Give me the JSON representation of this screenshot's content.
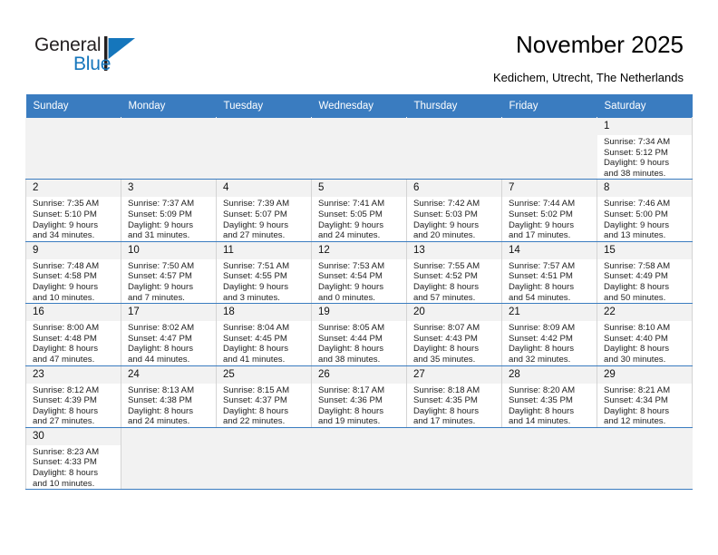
{
  "brand": {
    "name_top": "General",
    "name_bottom": "Blue",
    "flag_icon": "blue-triangle-flag-icon",
    "accent_color": "#1576bc"
  },
  "header": {
    "title": "November 2025",
    "subtitle": "Kedichem, Utrecht, The Netherlands"
  },
  "calendar": {
    "header_bg": "#3a7cc0",
    "daynum_bg": "#f2f2f2",
    "weekdays": [
      "Sunday",
      "Monday",
      "Tuesday",
      "Wednesday",
      "Thursday",
      "Friday",
      "Saturday"
    ],
    "weeks": [
      [
        {
          "empty": true
        },
        {
          "empty": true
        },
        {
          "empty": true
        },
        {
          "empty": true
        },
        {
          "empty": true
        },
        {
          "empty": true
        },
        {
          "day": "1",
          "sunrise": "Sunrise: 7:34 AM",
          "sunset": "Sunset: 5:12 PM",
          "daylight_1": "Daylight: 9 hours",
          "daylight_2": "and 38 minutes."
        }
      ],
      [
        {
          "day": "2",
          "sunrise": "Sunrise: 7:35 AM",
          "sunset": "Sunset: 5:10 PM",
          "daylight_1": "Daylight: 9 hours",
          "daylight_2": "and 34 minutes."
        },
        {
          "day": "3",
          "sunrise": "Sunrise: 7:37 AM",
          "sunset": "Sunset: 5:09 PM",
          "daylight_1": "Daylight: 9 hours",
          "daylight_2": "and 31 minutes."
        },
        {
          "day": "4",
          "sunrise": "Sunrise: 7:39 AM",
          "sunset": "Sunset: 5:07 PM",
          "daylight_1": "Daylight: 9 hours",
          "daylight_2": "and 27 minutes."
        },
        {
          "day": "5",
          "sunrise": "Sunrise: 7:41 AM",
          "sunset": "Sunset: 5:05 PM",
          "daylight_1": "Daylight: 9 hours",
          "daylight_2": "and 24 minutes."
        },
        {
          "day": "6",
          "sunrise": "Sunrise: 7:42 AM",
          "sunset": "Sunset: 5:03 PM",
          "daylight_1": "Daylight: 9 hours",
          "daylight_2": "and 20 minutes."
        },
        {
          "day": "7",
          "sunrise": "Sunrise: 7:44 AM",
          "sunset": "Sunset: 5:02 PM",
          "daylight_1": "Daylight: 9 hours",
          "daylight_2": "and 17 minutes."
        },
        {
          "day": "8",
          "sunrise": "Sunrise: 7:46 AM",
          "sunset": "Sunset: 5:00 PM",
          "daylight_1": "Daylight: 9 hours",
          "daylight_2": "and 13 minutes."
        }
      ],
      [
        {
          "day": "9",
          "sunrise": "Sunrise: 7:48 AM",
          "sunset": "Sunset: 4:58 PM",
          "daylight_1": "Daylight: 9 hours",
          "daylight_2": "and 10 minutes."
        },
        {
          "day": "10",
          "sunrise": "Sunrise: 7:50 AM",
          "sunset": "Sunset: 4:57 PM",
          "daylight_1": "Daylight: 9 hours",
          "daylight_2": "and 7 minutes."
        },
        {
          "day": "11",
          "sunrise": "Sunrise: 7:51 AM",
          "sunset": "Sunset: 4:55 PM",
          "daylight_1": "Daylight: 9 hours",
          "daylight_2": "and 3 minutes."
        },
        {
          "day": "12",
          "sunrise": "Sunrise: 7:53 AM",
          "sunset": "Sunset: 4:54 PM",
          "daylight_1": "Daylight: 9 hours",
          "daylight_2": "and 0 minutes."
        },
        {
          "day": "13",
          "sunrise": "Sunrise: 7:55 AM",
          "sunset": "Sunset: 4:52 PM",
          "daylight_1": "Daylight: 8 hours",
          "daylight_2": "and 57 minutes."
        },
        {
          "day": "14",
          "sunrise": "Sunrise: 7:57 AM",
          "sunset": "Sunset: 4:51 PM",
          "daylight_1": "Daylight: 8 hours",
          "daylight_2": "and 54 minutes."
        },
        {
          "day": "15",
          "sunrise": "Sunrise: 7:58 AM",
          "sunset": "Sunset: 4:49 PM",
          "daylight_1": "Daylight: 8 hours",
          "daylight_2": "and 50 minutes."
        }
      ],
      [
        {
          "day": "16",
          "sunrise": "Sunrise: 8:00 AM",
          "sunset": "Sunset: 4:48 PM",
          "daylight_1": "Daylight: 8 hours",
          "daylight_2": "and 47 minutes."
        },
        {
          "day": "17",
          "sunrise": "Sunrise: 8:02 AM",
          "sunset": "Sunset: 4:47 PM",
          "daylight_1": "Daylight: 8 hours",
          "daylight_2": "and 44 minutes."
        },
        {
          "day": "18",
          "sunrise": "Sunrise: 8:04 AM",
          "sunset": "Sunset: 4:45 PM",
          "daylight_1": "Daylight: 8 hours",
          "daylight_2": "and 41 minutes."
        },
        {
          "day": "19",
          "sunrise": "Sunrise: 8:05 AM",
          "sunset": "Sunset: 4:44 PM",
          "daylight_1": "Daylight: 8 hours",
          "daylight_2": "and 38 minutes."
        },
        {
          "day": "20",
          "sunrise": "Sunrise: 8:07 AM",
          "sunset": "Sunset: 4:43 PM",
          "daylight_1": "Daylight: 8 hours",
          "daylight_2": "and 35 minutes."
        },
        {
          "day": "21",
          "sunrise": "Sunrise: 8:09 AM",
          "sunset": "Sunset: 4:42 PM",
          "daylight_1": "Daylight: 8 hours",
          "daylight_2": "and 32 minutes."
        },
        {
          "day": "22",
          "sunrise": "Sunrise: 8:10 AM",
          "sunset": "Sunset: 4:40 PM",
          "daylight_1": "Daylight: 8 hours",
          "daylight_2": "and 30 minutes."
        }
      ],
      [
        {
          "day": "23",
          "sunrise": "Sunrise: 8:12 AM",
          "sunset": "Sunset: 4:39 PM",
          "daylight_1": "Daylight: 8 hours",
          "daylight_2": "and 27 minutes."
        },
        {
          "day": "24",
          "sunrise": "Sunrise: 8:13 AM",
          "sunset": "Sunset: 4:38 PM",
          "daylight_1": "Daylight: 8 hours",
          "daylight_2": "and 24 minutes."
        },
        {
          "day": "25",
          "sunrise": "Sunrise: 8:15 AM",
          "sunset": "Sunset: 4:37 PM",
          "daylight_1": "Daylight: 8 hours",
          "daylight_2": "and 22 minutes."
        },
        {
          "day": "26",
          "sunrise": "Sunrise: 8:17 AM",
          "sunset": "Sunset: 4:36 PM",
          "daylight_1": "Daylight: 8 hours",
          "daylight_2": "and 19 minutes."
        },
        {
          "day": "27",
          "sunrise": "Sunrise: 8:18 AM",
          "sunset": "Sunset: 4:35 PM",
          "daylight_1": "Daylight: 8 hours",
          "daylight_2": "and 17 minutes."
        },
        {
          "day": "28",
          "sunrise": "Sunrise: 8:20 AM",
          "sunset": "Sunset: 4:35 PM",
          "daylight_1": "Daylight: 8 hours",
          "daylight_2": "and 14 minutes."
        },
        {
          "day": "29",
          "sunrise": "Sunrise: 8:21 AM",
          "sunset": "Sunset: 4:34 PM",
          "daylight_1": "Daylight: 8 hours",
          "daylight_2": "and 12 minutes."
        }
      ],
      [
        {
          "day": "30",
          "sunrise": "Sunrise: 8:23 AM",
          "sunset": "Sunset: 4:33 PM",
          "daylight_1": "Daylight: 8 hours",
          "daylight_2": "and 10 minutes."
        },
        {
          "empty": true
        },
        {
          "empty": true
        },
        {
          "empty": true
        },
        {
          "empty": true
        },
        {
          "empty": true
        },
        {
          "empty": true
        }
      ]
    ]
  }
}
